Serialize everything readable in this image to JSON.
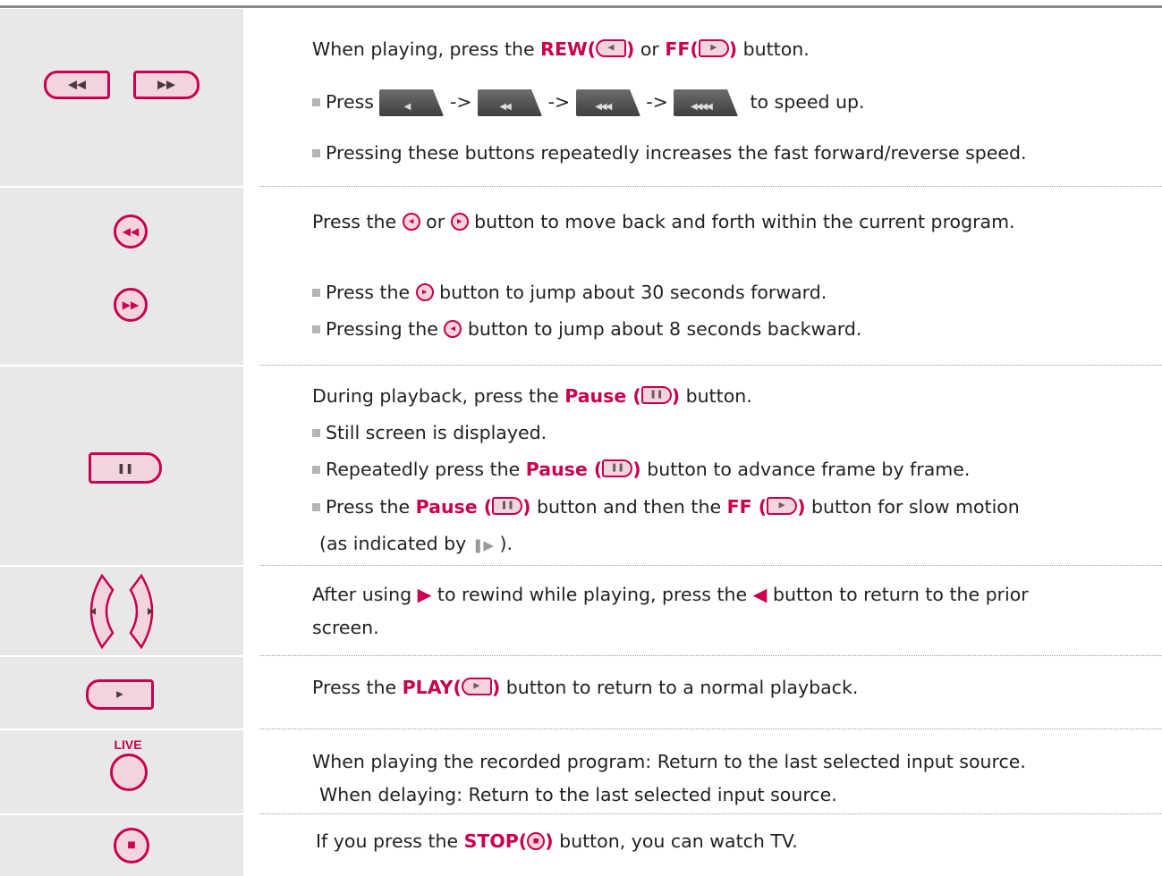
{
  "colors": {
    "accent": "#c8004f",
    "button_fill": "#f3d4dc",
    "sidebar": "#e8e8e8"
  },
  "rew_ff": {
    "line1": {
      "a": "When playing, press the ",
      "rew": "REW(",
      "close": ")",
      "or": " or ",
      "ff": "FF(",
      "end": " button."
    },
    "line2": {
      "a": "Press ",
      "arrow": "->",
      "end": "to speed up."
    },
    "line3": "Pressing these buttons repeatedly increases the fast forward/reverse speed."
  },
  "skip": {
    "line1": {
      "a": "Press the ",
      "or": " or ",
      "end": " button to move back and forth within the current program."
    },
    "line2": {
      "a": "Press the ",
      "end": " button to jump about 30 seconds forward."
    },
    "line3": {
      "a": "Pressing the ",
      "end": " button to jump about 8 seconds backward."
    }
  },
  "pause": {
    "line1": {
      "a": "During playback, press the ",
      "pause": "Pause (",
      "close": ")",
      "end": " button."
    },
    "line2": "Still screen is displayed.",
    "line3": {
      "a": "Repeatedly press the ",
      "pause": "Pause (",
      "close": ")",
      "end": " button to advance frame by frame."
    },
    "line4": {
      "a": "Press the ",
      "pause": "Pause (",
      "close": ")",
      "mid": " button and then the ",
      "ff": "FF (",
      "end": " button for slow motion"
    },
    "line5": {
      "a": "(as indicated by ",
      "end": " )."
    }
  },
  "arrows": {
    "line1": {
      "a": "After using ",
      "mid": " to rewind while playing, press the ",
      "end": " button to return to the prior"
    },
    "line2": "screen."
  },
  "play": {
    "a": "Press the ",
    "play": "PLAY(",
    "close": ")",
    "end": " button to return to a normal playback."
  },
  "live": {
    "label": "LIVE",
    "line1": "When playing the recorded program: Return to the last selected input source.",
    "line2": "When delaying: Return to the last selected input source."
  },
  "stop": {
    "a": "If you press the ",
    "stop": "STOP(",
    "close": ")",
    "end": " button, you can watch TV."
  },
  "icons": {
    "rew": "rewind-icon",
    "ff": "fast-forward-icon",
    "skip_back": "skip-back-icon",
    "skip_fwd": "skip-forward-icon",
    "pause": "pause-icon",
    "play": "play-icon",
    "stop": "stop-icon",
    "slow": "slow-motion-icon"
  }
}
